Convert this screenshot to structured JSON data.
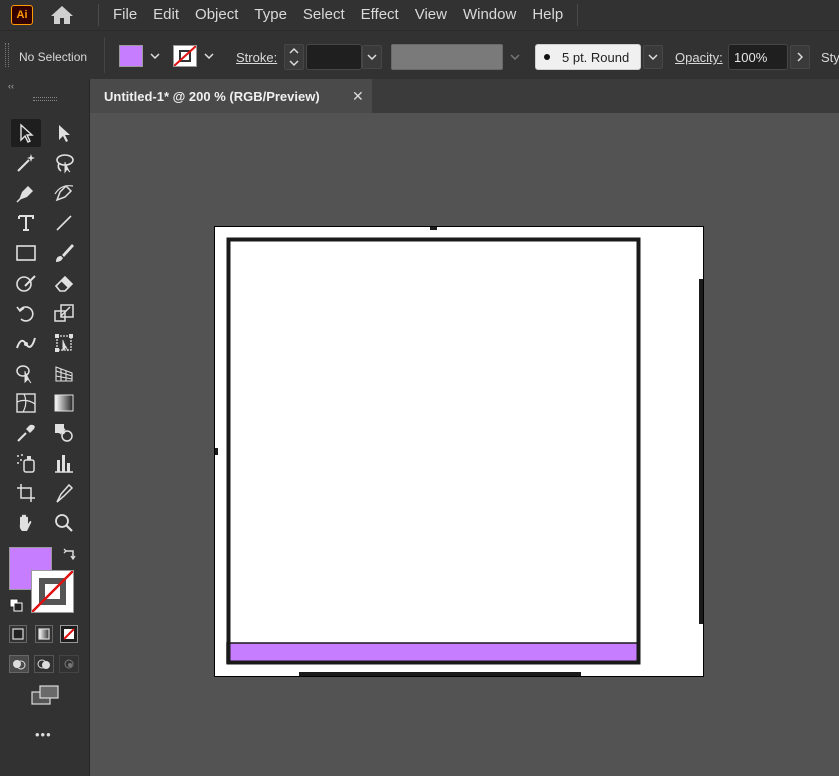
{
  "app": {
    "logo_text": "Ai"
  },
  "menu": [
    "File",
    "Edit",
    "Object",
    "Type",
    "Select",
    "Effect",
    "View",
    "Window",
    "Help"
  ],
  "control": {
    "selection_label": "No Selection",
    "fill_color": "#c77dff",
    "stroke_label": "Stroke:",
    "brush_label": "5 pt. Round",
    "opacity_label": "Opacity:",
    "opacity_value": "100%",
    "style_label": "Sty"
  },
  "document": {
    "tab_title": "Untitled-1* @ 200 % (RGB/Preview)",
    "close_glyph": "✕"
  },
  "toolbar": {
    "fill_color": "#c77dff",
    "more_glyph": "•••"
  },
  "colors": {
    "accent_purple": "#c77dff",
    "panel": "#323232",
    "canvas": "#535353",
    "stroke_black": "#1a1a1a"
  }
}
